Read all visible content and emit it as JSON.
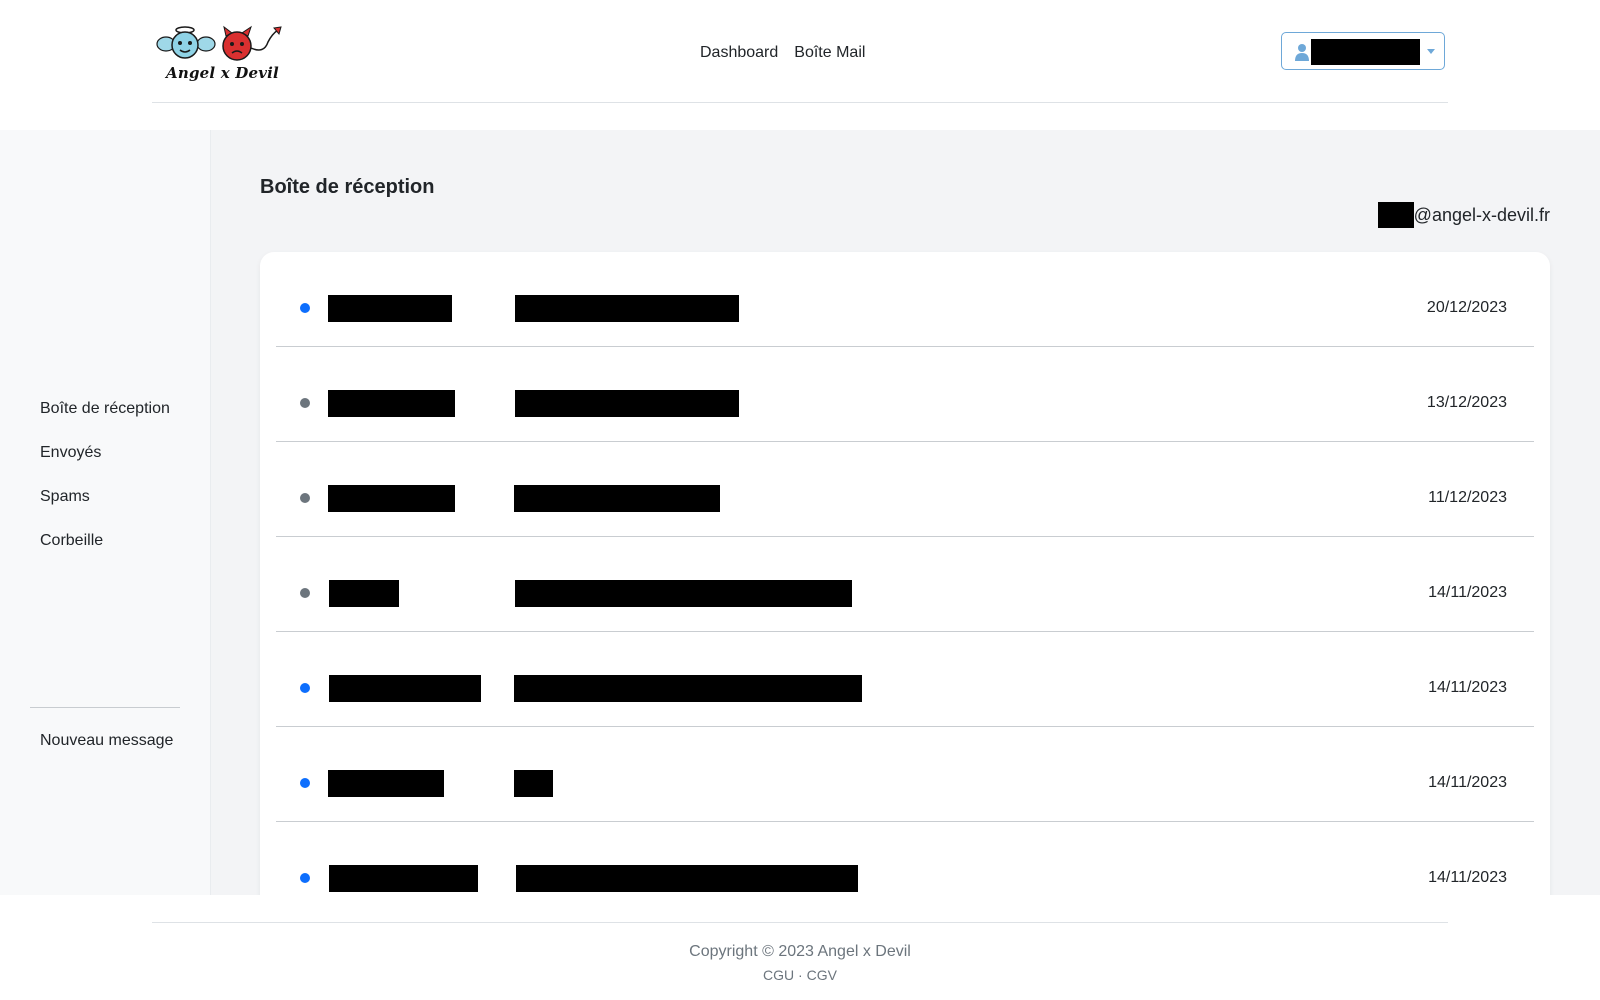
{
  "brand": {
    "logo_text": "Angel x Devil"
  },
  "nav": {
    "items": [
      "Dashboard",
      "Boîte Mail"
    ]
  },
  "user_menu": {
    "name": "████████"
  },
  "sidebar": {
    "items": [
      "Boîte de réception",
      "Envoyés",
      "Spams",
      "Corbeille"
    ],
    "new_message": "Nouveau message"
  },
  "main": {
    "title": "Boîte de réception",
    "mailbox_user": "███",
    "mailbox_domain": "@angel-x-devil.fr"
  },
  "emails": [
    {
      "unread": true,
      "sender": "██████████",
      "subject": "██████████████████",
      "date": "20/12/2023"
    },
    {
      "unread": false,
      "sender": "██████████",
      "subject": "██████████████████",
      "date": "13/12/2023"
    },
    {
      "unread": false,
      "sender": "██████████",
      "subject": "████████████████",
      "date": "11/12/2023"
    },
    {
      "unread": false,
      "sender": "██████",
      "subject": "███████████████████████████",
      "date": "14/11/2023"
    },
    {
      "unread": true,
      "sender": "████████████",
      "subject": "████████████████████████████",
      "date": "14/11/2023"
    },
    {
      "unread": true,
      "sender": "█████████",
      "subject": "███",
      "date": "14/11/2023"
    },
    {
      "unread": true,
      "sender": "████████████",
      "subject": "███████████████████████████",
      "date": "14/11/2023"
    }
  ],
  "colors": {
    "unread_dot": "#0d6efd",
    "read_dot": "#6c757d",
    "user_button_border": "#6ea8d8"
  },
  "footer": {
    "copyright": "Copyright © 2023 Angel x Devil",
    "links": [
      "CGU",
      "CGV"
    ],
    "separator": "·"
  }
}
